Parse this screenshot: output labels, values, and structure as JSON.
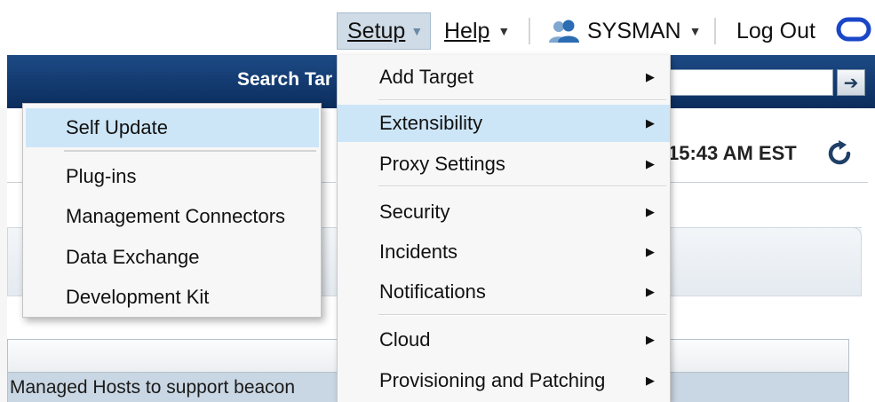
{
  "topnav": {
    "setup_label": "Setup",
    "help_label": "Help",
    "user_label": "SYSMAN",
    "logout_label": "Log Out",
    "caret": "▼"
  },
  "search": {
    "label": "Search Tar",
    "go_icon": "arrow-right-icon"
  },
  "page": {
    "refresh_time": "15:43 AM EST",
    "table_row_text": "Managed Hosts to support beacon"
  },
  "setup_menu": {
    "items": [
      {
        "label": "Add Target",
        "has_submenu": true
      },
      {
        "label": "Extensibility",
        "has_submenu": true,
        "active": true
      },
      {
        "label": "Proxy Settings",
        "has_submenu": true
      },
      {
        "label": "Security",
        "has_submenu": true
      },
      {
        "label": "Incidents",
        "has_submenu": true
      },
      {
        "label": "Notifications",
        "has_submenu": true
      },
      {
        "label": "Cloud",
        "has_submenu": true
      },
      {
        "label": "Provisioning and Patching",
        "has_submenu": true
      }
    ],
    "arrow": "▶"
  },
  "extensibility_submenu": {
    "items": [
      {
        "label": "Self Update",
        "active": true
      },
      {
        "label": "Plug-ins"
      },
      {
        "label": "Management Connectors"
      },
      {
        "label": "Data Exchange"
      },
      {
        "label": "Development Kit"
      }
    ]
  },
  "colors": {
    "search_band": "#0b2d5d",
    "menu_highlight": "#cde6f7",
    "oracle_logo": "#1a46c8"
  }
}
